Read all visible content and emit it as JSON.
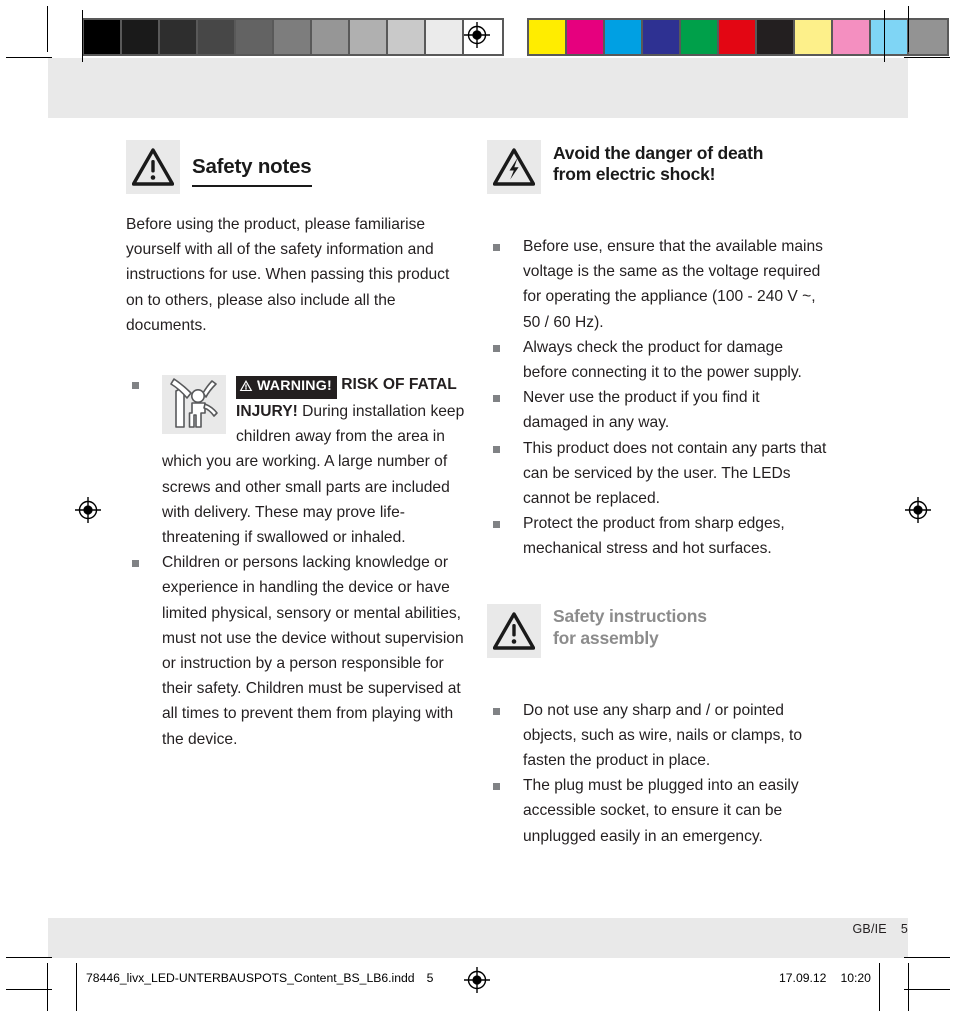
{
  "print_marks": {
    "grayscale_swatches": [
      "#000000",
      "#1a1a1a",
      "#2e2e2e",
      "#474747",
      "#636363",
      "#7d7d7d",
      "#969696",
      "#b0b0b0",
      "#c9c9c9",
      "#ebebeb",
      "#ffffff"
    ],
    "color_swatches": [
      "#ffed00",
      "#e6007e",
      "#00a0e3",
      "#2e3192",
      "#00a04a",
      "#e30613",
      "#231f20",
      "#fdf08a",
      "#f48fc0",
      "#7fd5f5",
      "#939393"
    ],
    "registration_icon": "registration-target-icon"
  },
  "left_column": {
    "heading": {
      "icon": "warning-triangle-exclamation-icon",
      "title": "Safety notes"
    },
    "intro": "Before using the product, please familiarise yourself with all of the safety information and instructions for use. When passing this product on to others, please also include all the documents.",
    "bullets": [
      {
        "figure_icon": "child-reaching-hazard-icon",
        "badge_icon": "warning-triangle-small-icon",
        "badge_label": "WARNING!",
        "lead": "RISK OF FATAL INJURY!",
        "text": "During installation keep children away from the area in which you are working. A large number of screws and other small parts are included with delivery. These may prove life-threatening if swallowed or inhaled."
      },
      {
        "text": "Children or persons lacking knowledge or experience in handling the device or have limited physical, sensory or mental abilities, must not use the device without supervision or instruction by a person responsible for their safety. Children must be supervised at all times to prevent them from playing with the device."
      }
    ]
  },
  "right_column": {
    "heading_electric": {
      "icon": "electric-shock-triangle-icon",
      "title_line1": "Avoid the danger of death",
      "title_line2": "from electric shock!"
    },
    "electric_bullets": [
      "Before use, ensure that the available mains voltage is the same as the voltage required for operating the appliance (100 - 240 V ~, 50 / 60 Hz).",
      "Always check the product for damage before connecting it to the power supply.",
      "Never use the product if you find it damaged in any way.",
      "This product does not contain any parts that can be serviced by the user. The LEDs cannot be replaced.",
      "Protect the product from sharp edges, mechanical stress and hot surfaces."
    ],
    "heading_assembly": {
      "icon": "warning-triangle-exclamation-icon",
      "title_line1": "Safety instructions",
      "title_line2": "for assembly"
    },
    "assembly_bullets": [
      "Do not use any sharp and / or pointed objects, such as wire, nails or clamps, to fasten the product in place.",
      "The plug must be plugged into an easily accessible socket, to ensure it can be unplugged easily in an emergency."
    ]
  },
  "footer": {
    "locale": "GB/IE",
    "page_number": "5",
    "slug_filename": "78446_livx_LED-UNTERBAUSPOTS_Content_BS_LB6.indd",
    "slug_folio": "5",
    "slug_date": "17.09.12",
    "slug_time": "10:20"
  },
  "colors": {
    "band": "#e9e9e9",
    "text": "#231f20",
    "bullet": "#808285",
    "gray_heading": "#8c8c8c",
    "badge_bg": "#231f20"
  }
}
